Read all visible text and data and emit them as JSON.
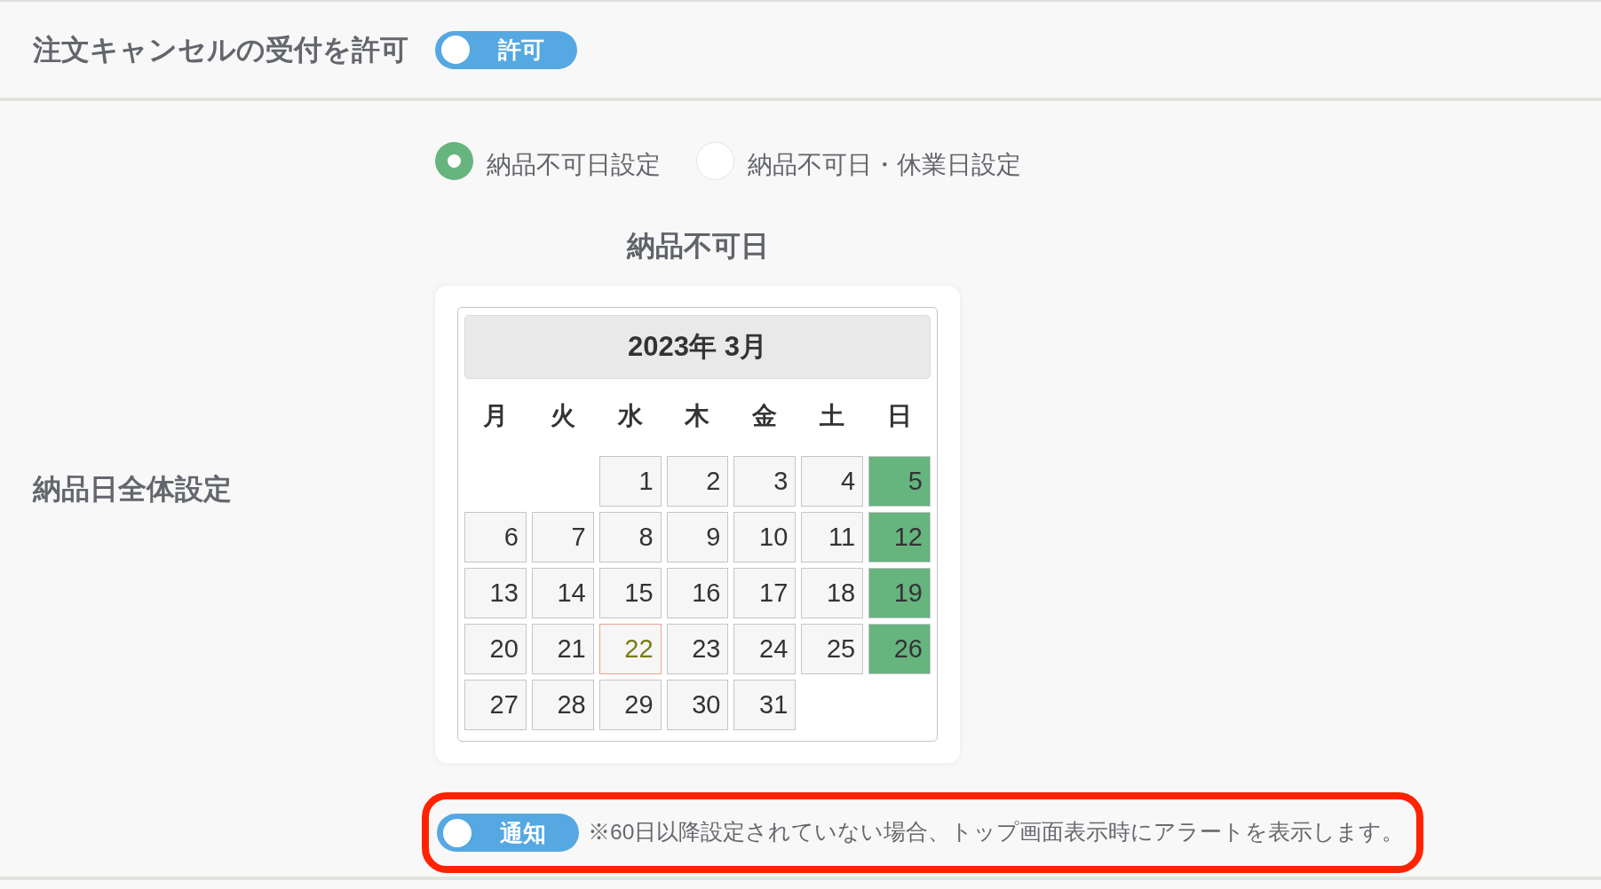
{
  "cancel_setting": {
    "label": "注文キャンセルの受付を許可",
    "toggle": {
      "label": "許可",
      "on": true
    }
  },
  "delivery_setting": {
    "label": "納品日全体設定",
    "modes": [
      {
        "label": "納品不可日設定",
        "selected": true
      },
      {
        "label": "納品不可日・休業日設定",
        "selected": false
      }
    ],
    "calendar_heading": "納品不可日",
    "calendar": {
      "title": "2023年 3月",
      "weekdays": [
        "月",
        "火",
        "水",
        "木",
        "金",
        "土",
        "日"
      ],
      "weeks": [
        {
          "days": [
            {
              "kind": "blank"
            },
            {
              "kind": "blank"
            },
            {
              "kind": "day",
              "label": "1",
              "selected": false,
              "today": false
            },
            {
              "kind": "day",
              "label": "2",
              "selected": false,
              "today": false
            },
            {
              "kind": "day",
              "label": "3",
              "selected": false,
              "today": false
            },
            {
              "kind": "day",
              "label": "4",
              "selected": false,
              "today": false
            },
            {
              "kind": "day",
              "label": "5",
              "selected": true,
              "today": false
            }
          ]
        },
        {
          "days": [
            {
              "kind": "day",
              "label": "6",
              "selected": false,
              "today": false
            },
            {
              "kind": "day",
              "label": "7",
              "selected": false,
              "today": false
            },
            {
              "kind": "day",
              "label": "8",
              "selected": false,
              "today": false
            },
            {
              "kind": "day",
              "label": "9",
              "selected": false,
              "today": false
            },
            {
              "kind": "day",
              "label": "10",
              "selected": false,
              "today": false
            },
            {
              "kind": "day",
              "label": "11",
              "selected": false,
              "today": false
            },
            {
              "kind": "day",
              "label": "12",
              "selected": true,
              "today": false
            }
          ]
        },
        {
          "days": [
            {
              "kind": "day",
              "label": "13",
              "selected": false,
              "today": false
            },
            {
              "kind": "day",
              "label": "14",
              "selected": false,
              "today": false
            },
            {
              "kind": "day",
              "label": "15",
              "selected": false,
              "today": false
            },
            {
              "kind": "day",
              "label": "16",
              "selected": false,
              "today": false
            },
            {
              "kind": "day",
              "label": "17",
              "selected": false,
              "today": false
            },
            {
              "kind": "day",
              "label": "18",
              "selected": false,
              "today": false
            },
            {
              "kind": "day",
              "label": "19",
              "selected": true,
              "today": false
            }
          ]
        },
        {
          "days": [
            {
              "kind": "day",
              "label": "20",
              "selected": false,
              "today": false
            },
            {
              "kind": "day",
              "label": "21",
              "selected": false,
              "today": false
            },
            {
              "kind": "day",
              "label": "22",
              "selected": false,
              "today": true
            },
            {
              "kind": "day",
              "label": "23",
              "selected": false,
              "today": false
            },
            {
              "kind": "day",
              "label": "24",
              "selected": false,
              "today": false
            },
            {
              "kind": "day",
              "label": "25",
              "selected": false,
              "today": false
            },
            {
              "kind": "day",
              "label": "26",
              "selected": true,
              "today": false
            }
          ]
        },
        {
          "days": [
            {
              "kind": "day",
              "label": "27",
              "selected": false,
              "today": false
            },
            {
              "kind": "day",
              "label": "28",
              "selected": false,
              "today": false
            },
            {
              "kind": "day",
              "label": "29",
              "selected": false,
              "today": false
            },
            {
              "kind": "day",
              "label": "30",
              "selected": false,
              "today": false
            },
            {
              "kind": "day",
              "label": "31",
              "selected": false,
              "today": false
            }
          ]
        }
      ]
    },
    "notify": {
      "highlighted": true,
      "toggle": {
        "label": "通知",
        "on": true
      },
      "note": "※60日以降設定されていない場合、トップ画面表示時にアラートを表示します。"
    }
  }
}
